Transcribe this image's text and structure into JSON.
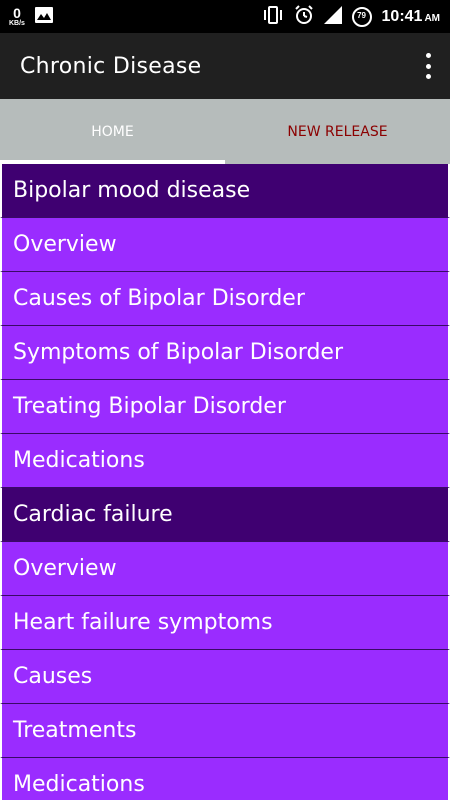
{
  "status_bar": {
    "net_speed_value": "0",
    "net_speed_unit": "KB/s",
    "battery_level": "79",
    "time": "10:41",
    "ampm": "AM"
  },
  "app_bar": {
    "title": "Chronic Disease"
  },
  "tabs": [
    {
      "label": "HOME",
      "selected": true,
      "color": "#ffffff"
    },
    {
      "label": "NEW RELEASE",
      "selected": false,
      "color": "#8b0000"
    }
  ],
  "colors": {
    "app_bar": "#202020",
    "tab_bar": "#b6bcbb",
    "section_header": "#3f0071",
    "list_item": "#9a2cff"
  },
  "list": [
    {
      "type": "header",
      "label": "Bipolar mood disease"
    },
    {
      "type": "item",
      "label": "Overview"
    },
    {
      "type": "item",
      "label": "Causes of Bipolar Disorder"
    },
    {
      "type": "item",
      "label": "Symptoms of Bipolar Disorder"
    },
    {
      "type": "item",
      "label": "Treating Bipolar Disorder"
    },
    {
      "type": "item",
      "label": "Medications"
    },
    {
      "type": "header",
      "label": "Cardiac failure"
    },
    {
      "type": "item",
      "label": "Overview"
    },
    {
      "type": "item",
      "label": "Heart failure symptoms"
    },
    {
      "type": "item",
      "label": "Causes"
    },
    {
      "type": "item",
      "label": "Treatments"
    },
    {
      "type": "item",
      "label": "Medications"
    }
  ]
}
